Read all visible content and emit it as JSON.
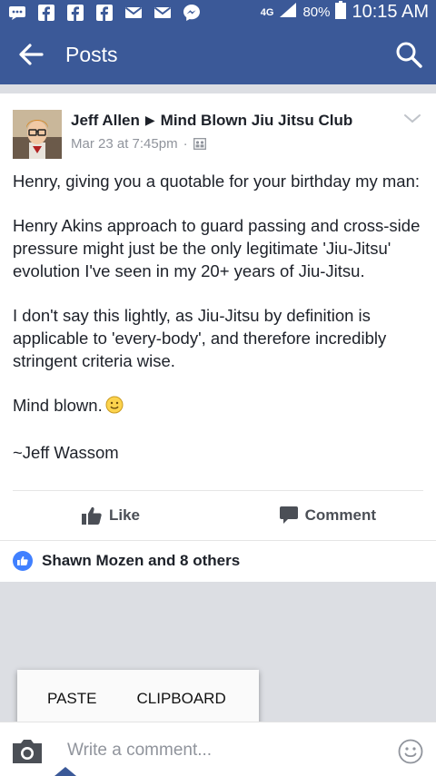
{
  "colors": {
    "brand": "#3b5998",
    "background_gray": "#dcdee3",
    "secondary_text": "#90949c",
    "like_blue": "#4080ff"
  },
  "status_bar": {
    "icons": [
      "messenger-icon",
      "facebook-icon",
      "facebook-icon",
      "facebook-icon",
      "gmail-icon",
      "gmail-icon",
      "messenger-icon"
    ],
    "network": "4G",
    "battery": "80%",
    "time": "10:15 AM"
  },
  "app_bar": {
    "title": "Posts",
    "back_icon": "arrow-left-icon",
    "search_icon": "search-icon"
  },
  "post": {
    "author": "Jeff Allen",
    "group": "Mind Blown Jiu Jitsu Club",
    "timestamp": "Mar 23 at 7:45pm",
    "separator": "·",
    "privacy_icon": "group-icon",
    "paragraphs": [
      "Henry, giving you a quotable for your birthday my man:",
      "Henry Akins approach to guard passing and cross-side pressure might just be the only legitimate 'Jiu-Jitsu' evolution I've seen in my 20+ years of Jiu-Jitsu.",
      "I don't say this lightly, as Jiu-Jitsu by definition is applicable to 'every-body', and therefore incredibly stringent criteria wise.",
      "Mind blown.",
      "~Jeff Wassom"
    ],
    "like_label": "Like",
    "comment_label": "Comment",
    "reactions_text": "Shawn Mozen and 8 others"
  },
  "paste_menu": {
    "paste_label": "PASTE",
    "clipboard_label": "CLIPBOARD"
  },
  "comment_bar": {
    "placeholder": "Write a comment..."
  }
}
